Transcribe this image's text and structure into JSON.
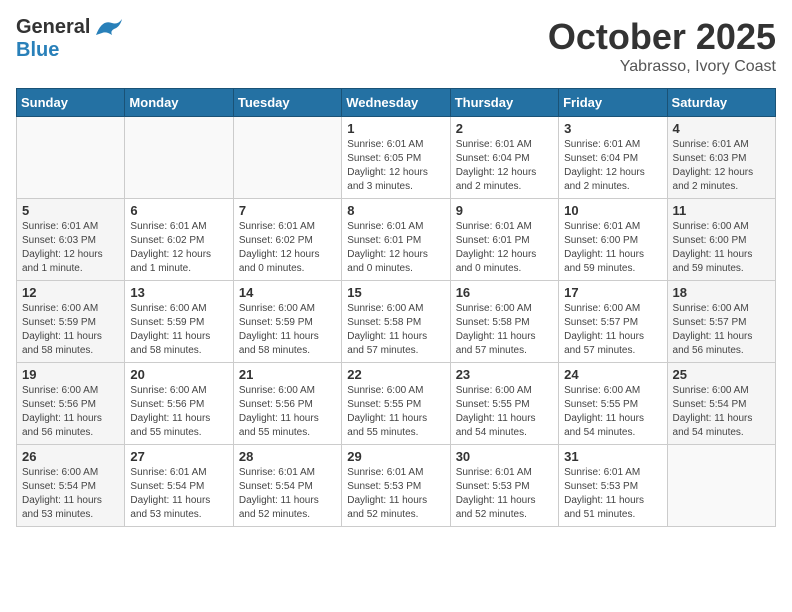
{
  "header": {
    "logo_general": "General",
    "logo_blue": "Blue",
    "month": "October 2025",
    "location": "Yabrasso, Ivory Coast"
  },
  "weekdays": [
    "Sunday",
    "Monday",
    "Tuesday",
    "Wednesday",
    "Thursday",
    "Friday",
    "Saturday"
  ],
  "weeks": [
    [
      {
        "day": "",
        "info": ""
      },
      {
        "day": "",
        "info": ""
      },
      {
        "day": "",
        "info": ""
      },
      {
        "day": "1",
        "info": "Sunrise: 6:01 AM\nSunset: 6:05 PM\nDaylight: 12 hours and 3 minutes."
      },
      {
        "day": "2",
        "info": "Sunrise: 6:01 AM\nSunset: 6:04 PM\nDaylight: 12 hours and 2 minutes."
      },
      {
        "day": "3",
        "info": "Sunrise: 6:01 AM\nSunset: 6:04 PM\nDaylight: 12 hours and 2 minutes."
      },
      {
        "day": "4",
        "info": "Sunrise: 6:01 AM\nSunset: 6:03 PM\nDaylight: 12 hours and 2 minutes."
      }
    ],
    [
      {
        "day": "5",
        "info": "Sunrise: 6:01 AM\nSunset: 6:03 PM\nDaylight: 12 hours and 1 minute."
      },
      {
        "day": "6",
        "info": "Sunrise: 6:01 AM\nSunset: 6:02 PM\nDaylight: 12 hours and 1 minute."
      },
      {
        "day": "7",
        "info": "Sunrise: 6:01 AM\nSunset: 6:02 PM\nDaylight: 12 hours and 0 minutes."
      },
      {
        "day": "8",
        "info": "Sunrise: 6:01 AM\nSunset: 6:01 PM\nDaylight: 12 hours and 0 minutes."
      },
      {
        "day": "9",
        "info": "Sunrise: 6:01 AM\nSunset: 6:01 PM\nDaylight: 12 hours and 0 minutes."
      },
      {
        "day": "10",
        "info": "Sunrise: 6:01 AM\nSunset: 6:00 PM\nDaylight: 11 hours and 59 minutes."
      },
      {
        "day": "11",
        "info": "Sunrise: 6:00 AM\nSunset: 6:00 PM\nDaylight: 11 hours and 59 minutes."
      }
    ],
    [
      {
        "day": "12",
        "info": "Sunrise: 6:00 AM\nSunset: 5:59 PM\nDaylight: 11 hours and 58 minutes."
      },
      {
        "day": "13",
        "info": "Sunrise: 6:00 AM\nSunset: 5:59 PM\nDaylight: 11 hours and 58 minutes."
      },
      {
        "day": "14",
        "info": "Sunrise: 6:00 AM\nSunset: 5:59 PM\nDaylight: 11 hours and 58 minutes."
      },
      {
        "day": "15",
        "info": "Sunrise: 6:00 AM\nSunset: 5:58 PM\nDaylight: 11 hours and 57 minutes."
      },
      {
        "day": "16",
        "info": "Sunrise: 6:00 AM\nSunset: 5:58 PM\nDaylight: 11 hours and 57 minutes."
      },
      {
        "day": "17",
        "info": "Sunrise: 6:00 AM\nSunset: 5:57 PM\nDaylight: 11 hours and 57 minutes."
      },
      {
        "day": "18",
        "info": "Sunrise: 6:00 AM\nSunset: 5:57 PM\nDaylight: 11 hours and 56 minutes."
      }
    ],
    [
      {
        "day": "19",
        "info": "Sunrise: 6:00 AM\nSunset: 5:56 PM\nDaylight: 11 hours and 56 minutes."
      },
      {
        "day": "20",
        "info": "Sunrise: 6:00 AM\nSunset: 5:56 PM\nDaylight: 11 hours and 55 minutes."
      },
      {
        "day": "21",
        "info": "Sunrise: 6:00 AM\nSunset: 5:56 PM\nDaylight: 11 hours and 55 minutes."
      },
      {
        "day": "22",
        "info": "Sunrise: 6:00 AM\nSunset: 5:55 PM\nDaylight: 11 hours and 55 minutes."
      },
      {
        "day": "23",
        "info": "Sunrise: 6:00 AM\nSunset: 5:55 PM\nDaylight: 11 hours and 54 minutes."
      },
      {
        "day": "24",
        "info": "Sunrise: 6:00 AM\nSunset: 5:55 PM\nDaylight: 11 hours and 54 minutes."
      },
      {
        "day": "25",
        "info": "Sunrise: 6:00 AM\nSunset: 5:54 PM\nDaylight: 11 hours and 54 minutes."
      }
    ],
    [
      {
        "day": "26",
        "info": "Sunrise: 6:00 AM\nSunset: 5:54 PM\nDaylight: 11 hours and 53 minutes."
      },
      {
        "day": "27",
        "info": "Sunrise: 6:01 AM\nSunset: 5:54 PM\nDaylight: 11 hours and 53 minutes."
      },
      {
        "day": "28",
        "info": "Sunrise: 6:01 AM\nSunset: 5:54 PM\nDaylight: 11 hours and 52 minutes."
      },
      {
        "day": "29",
        "info": "Sunrise: 6:01 AM\nSunset: 5:53 PM\nDaylight: 11 hours and 52 minutes."
      },
      {
        "day": "30",
        "info": "Sunrise: 6:01 AM\nSunset: 5:53 PM\nDaylight: 11 hours and 52 minutes."
      },
      {
        "day": "31",
        "info": "Sunrise: 6:01 AM\nSunset: 5:53 PM\nDaylight: 11 hours and 51 minutes."
      },
      {
        "day": "",
        "info": ""
      }
    ]
  ],
  "colors": {
    "header_bg": "#2471a3",
    "accent": "#2980b9"
  }
}
